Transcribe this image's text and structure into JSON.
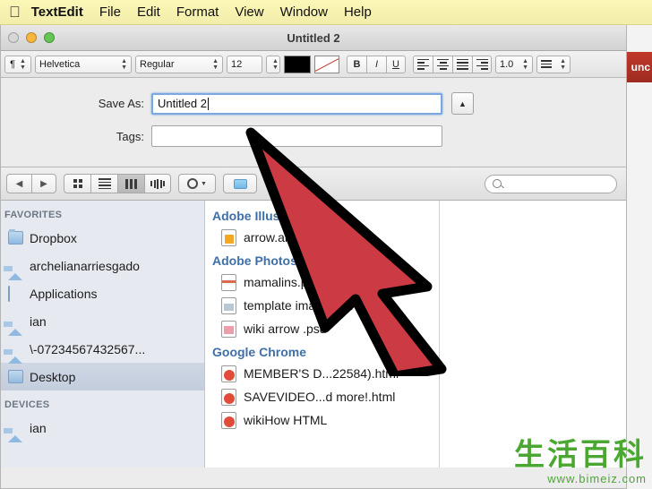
{
  "menubar": {
    "apple_icon": "apple-logo",
    "app_name": "TextEdit",
    "items": [
      "File",
      "Edit",
      "Format",
      "View",
      "Window",
      "Help"
    ]
  },
  "window": {
    "title": "Untitled 2",
    "traffic_lights": [
      "close",
      "minimize",
      "zoom"
    ]
  },
  "format_toolbar": {
    "paragraph_style": "¶",
    "font_family": "Helvetica",
    "font_style": "Regular",
    "font_size": "12",
    "text_color": "#000000",
    "highlight_color": "none",
    "bold_label": "B",
    "italic_label": "I",
    "underline_label": "U",
    "line_spacing": "1.0",
    "list_label": "list"
  },
  "save_sheet": {
    "save_as_label": "Save As:",
    "save_as_value": "Untitled 2",
    "tags_label": "Tags:",
    "tags_value": "",
    "tags_placeholder": "",
    "disclosure_icon": "chevron-up-icon"
  },
  "browser_toolbar": {
    "back_icon": "◀",
    "forward_icon": "▶",
    "view_modes": [
      "icon-view",
      "list-view",
      "column-view",
      "coverflow-view"
    ],
    "active_view": "column-view",
    "action_icon": "gear-icon",
    "folder_icon": "folder-icon",
    "search_placeholder": ""
  },
  "sidebar": {
    "sections": [
      {
        "heading": "FAVORITES",
        "items": [
          {
            "label": "Dropbox",
            "icon": "folder-icon",
            "selected": false
          },
          {
            "label": "archelianarriesgado",
            "icon": "home-icon",
            "selected": false
          },
          {
            "label": "Applications",
            "icon": "applications-icon",
            "selected": false
          },
          {
            "label": "ian",
            "icon": "home-icon",
            "selected": false
          },
          {
            "label": "\\-07234567432567...",
            "icon": "home-icon",
            "selected": false
          },
          {
            "label": "Desktop",
            "icon": "desktop-icon",
            "selected": true
          }
        ]
      },
      {
        "heading": "DEVICES",
        "items": [
          {
            "label": "ian",
            "icon": "home-icon",
            "selected": false
          }
        ]
      }
    ]
  },
  "file_list": {
    "groups": [
      {
        "heading": "Adobe Illustrator",
        "files": [
          {
            "name": "arrow.ai",
            "icon": "ai-file-icon"
          }
        ]
      },
      {
        "heading": "Adobe Photoshop",
        "files": [
          {
            "name": "mamalins.psd",
            "icon": "psd-file-icon"
          },
          {
            "name": "template image.psd",
            "icon": "image-file-icon"
          },
          {
            "name": "wiki arrow .psd",
            "icon": "psd-file-icon"
          }
        ]
      },
      {
        "heading": "Google Chrome",
        "files": [
          {
            "name": "MEMBER'S D...22584).html",
            "icon": "html-file-icon"
          },
          {
            "name": "SAVEVIDEO...d more!.html",
            "icon": "html-file-icon"
          },
          {
            "name": "wikiHow HTML",
            "icon": "html-file-icon"
          }
        ]
      }
    ]
  },
  "edge_app": {
    "label": "unc"
  },
  "cursor": {
    "type": "red-arrow-pointer",
    "fill_color": "#cc3b44",
    "stroke_color": "#000000"
  },
  "watermark": {
    "cjk_line": "生活百科",
    "url": "www.bimeiz.com",
    "green": "#4aa832",
    "gold": "#d8b33a"
  }
}
